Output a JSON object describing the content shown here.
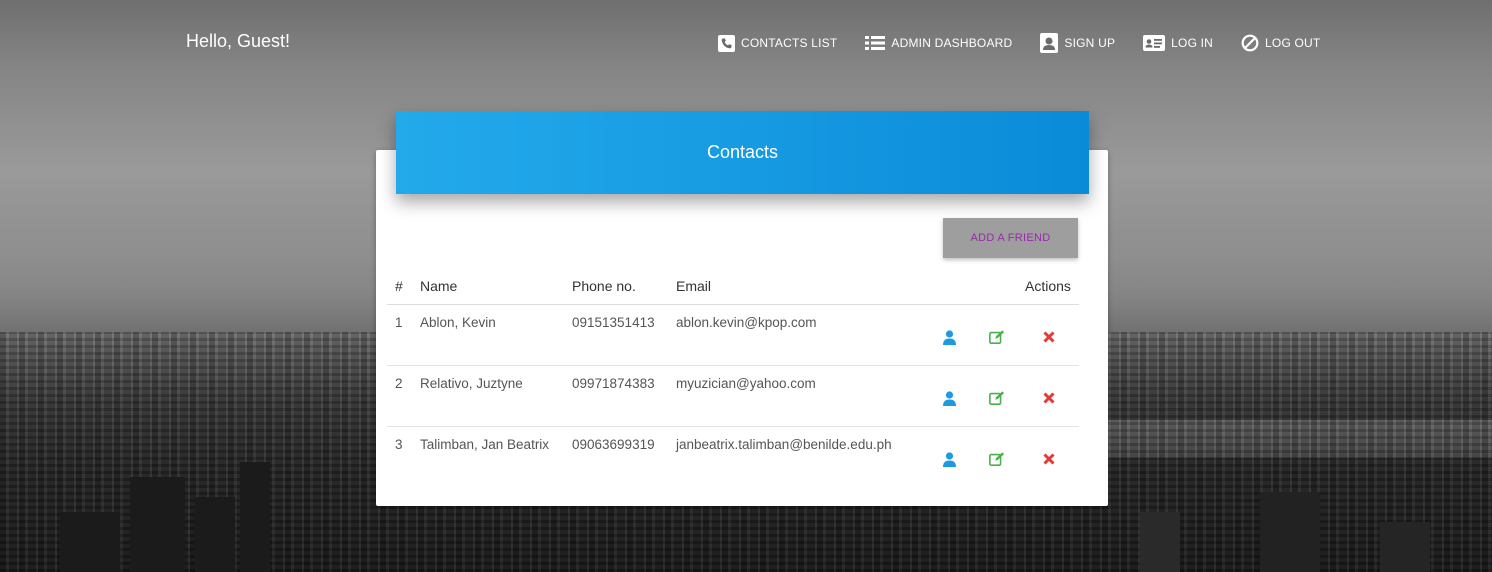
{
  "greeting": "Hello, Guest!",
  "nav": [
    {
      "label": "CONTACTS LIST",
      "icon": "phone-icon"
    },
    {
      "label": "ADMIN DASHBOARD",
      "icon": "list-icon"
    },
    {
      "label": "SIGN UP",
      "icon": "user-icon"
    },
    {
      "label": "LOG IN",
      "icon": "id-card-icon"
    },
    {
      "label": "LOG OUT",
      "icon": "ban-icon"
    }
  ],
  "card": {
    "title": "Contacts",
    "add_button": "ADD A FRIEND",
    "headers": {
      "num": "#",
      "name": "Name",
      "phone": "Phone no.",
      "email": "Email",
      "actions": "Actions"
    },
    "rows": [
      {
        "num": "1",
        "name": "Ablon, Kevin",
        "phone": "09151351413",
        "email": "ablon.kevin@kpop.com"
      },
      {
        "num": "2",
        "name": "Relativo, Juztyne",
        "phone": "09971874383",
        "email": "myuzician@yahoo.com"
      },
      {
        "num": "3",
        "name": "Talimban, Jan Beatrix",
        "phone": "09063699319",
        "email": "janbeatrix.talimban@benilde.edu.ph"
      }
    ]
  },
  "colors": {
    "header_start": "#23aaeb",
    "header_end": "#0a8bd8",
    "view_icon": "#1e9be0",
    "edit_icon": "#4caf50",
    "delete_icon": "#e53935",
    "add_button_text": "#9c27b0"
  }
}
